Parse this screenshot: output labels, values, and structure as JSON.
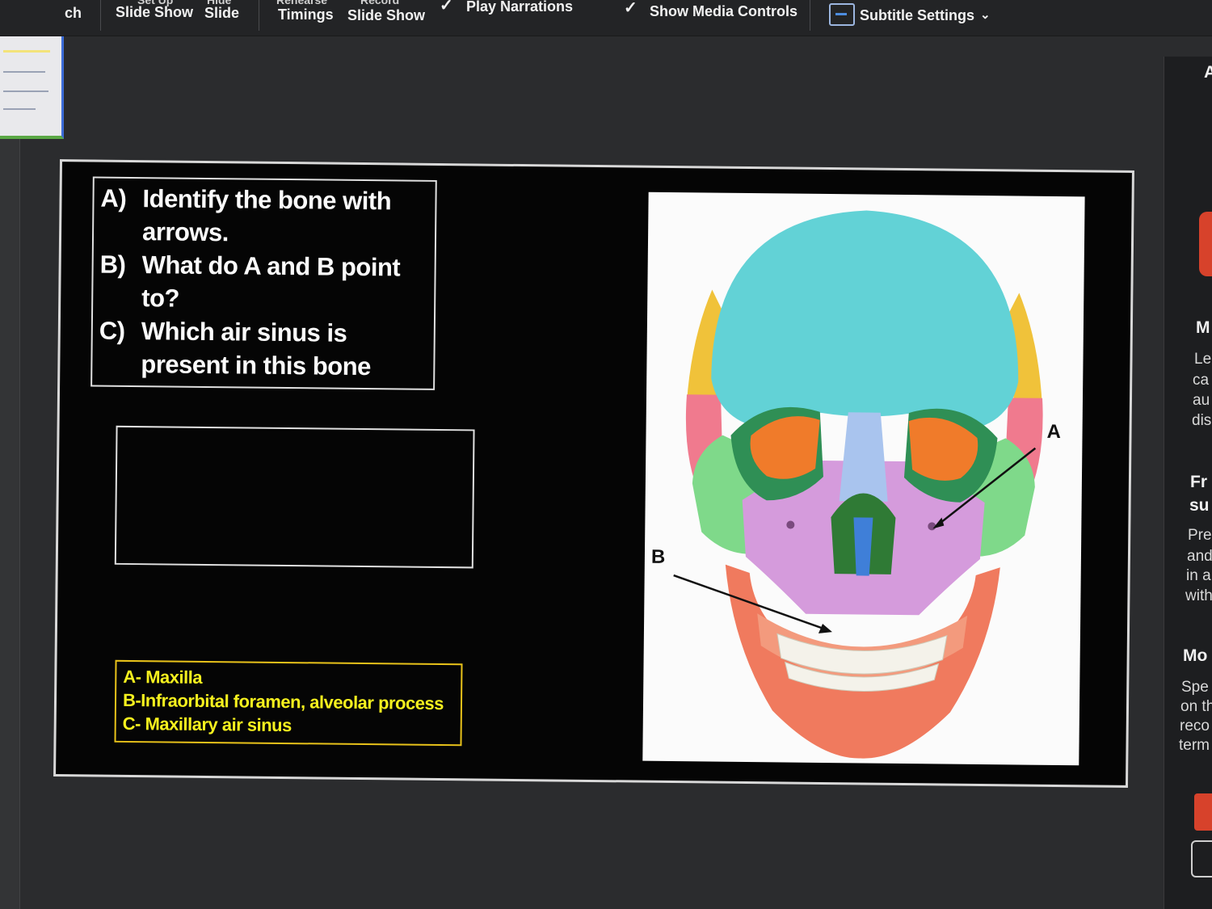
{
  "ribbon": {
    "items": [
      {
        "top": "",
        "label": "ch"
      },
      {
        "top": "Set Up",
        "label": "Slide Show"
      },
      {
        "top": "Hide",
        "label": "Slide"
      },
      {
        "top": "Rehearse",
        "label": "Timings"
      },
      {
        "top": "Record",
        "label": "Slide Show"
      }
    ],
    "checkboxes": [
      {
        "label": "Play Narrations",
        "checked": true
      },
      {
        "label": "Show Media Controls",
        "checked": true
      }
    ],
    "subtitle_settings": "Subtitle Settings"
  },
  "slide": {
    "questions": [
      {
        "letter": "A)",
        "line1": "Identify the bone with",
        "line2": "arrows."
      },
      {
        "letter": "B)",
        "line1": "What do A and B point",
        "line2": "to?"
      },
      {
        "letter": "C)",
        "line1": "Which air sinus is",
        "line2": "present in this bone"
      }
    ],
    "answers": [
      "A- Maxilla",
      "B-Infraorbital foramen, alveolar process",
      "C- Maxillary air sinus"
    ],
    "figure_labels": {
      "a": "A",
      "b": "B"
    }
  },
  "right_pane": {
    "lines": [
      {
        "text": "A",
        "bold": true
      },
      {
        "text": "M",
        "bold": true
      },
      {
        "text": "Le",
        "bold": false
      },
      {
        "text": "ca",
        "bold": false
      },
      {
        "text": "au",
        "bold": false
      },
      {
        "text": "dis",
        "bold": false
      },
      {
        "text": "Fr",
        "bold": true
      },
      {
        "text": "su",
        "bold": true
      },
      {
        "text": "Pre",
        "bold": false
      },
      {
        "text": "and",
        "bold": false
      },
      {
        "text": "in a",
        "bold": false
      },
      {
        "text": "with",
        "bold": false
      },
      {
        "text": "Mo",
        "bold": true
      },
      {
        "text": "Spe",
        "bold": false
      },
      {
        "text": "on th",
        "bold": false
      },
      {
        "text": "reco",
        "bold": false
      },
      {
        "text": "term",
        "bold": false
      }
    ]
  },
  "colors": {
    "frontal": "#62d2d6",
    "zygomatic": "#7fd98a",
    "maxilla": "#d59bdc",
    "mandible": "#f07a5e",
    "orbit": "#f07b2a",
    "answer_text": "#f6f11e"
  },
  "icons": [
    "checkmark-icon",
    "subtitle-settings-icon",
    "chevron-down-icon"
  ]
}
